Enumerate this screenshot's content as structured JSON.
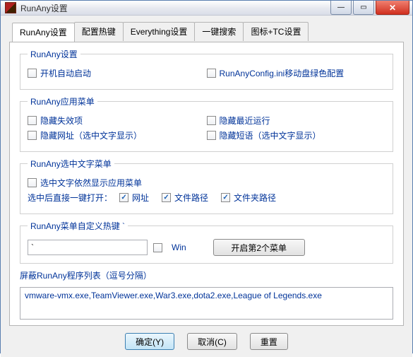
{
  "window": {
    "title": "RunAny设置"
  },
  "win_controls": {
    "min_glyph": "—",
    "max_glyph": "▭",
    "close_glyph": "✕"
  },
  "tabs": [
    {
      "label": "RunAny设置",
      "active": true
    },
    {
      "label": "配置热键"
    },
    {
      "label": "Everything设置"
    },
    {
      "label": "一键搜索"
    },
    {
      "label": "图标+TC设置"
    }
  ],
  "group_settings": {
    "legend": "RunAny设置",
    "autostart": "开机自动启动",
    "portable": "RunAnyConfig.ini移动盘绿色配置"
  },
  "group_menu": {
    "legend": "RunAny应用菜单",
    "hide_invalid": "隐藏失效项",
    "hide_recent": "隐藏最近运行",
    "hide_url": "隐藏网址（选中文字显示）",
    "hide_short": "隐藏短语（选中文字显示）"
  },
  "group_sel": {
    "legend": "RunAny选中文字菜单",
    "still_show": "选中文字依然显示应用菜单",
    "direct_open_label": "选中后直接一键打开：",
    "url": "网址",
    "file_path": "文件路径",
    "folder_path": "文件夹路径"
  },
  "group_hotkey": {
    "legend": "RunAny菜单自定义热键 `",
    "hotkey_value": "`",
    "win_label": "Win",
    "open2_label": "开启第2个菜单"
  },
  "blocklist": {
    "label": "屏蔽RunAny程序列表（逗号分隔）",
    "value": "vmware-vmx.exe,TeamViewer.exe,War3.exe,dota2.exe,League of Legends.exe"
  },
  "buttons": {
    "ok": "确定(Y)",
    "cancel": "取消(C)",
    "reset": "重置"
  }
}
